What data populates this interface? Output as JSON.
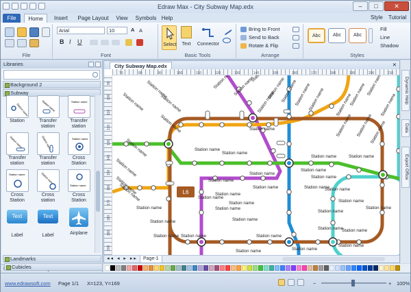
{
  "window": {
    "title": "Edraw Max - City Subway Map.edx"
  },
  "tabs": {
    "file": "File",
    "home": "Home",
    "insert": "Insert",
    "page_layout": "Page Layout",
    "view": "View",
    "symbols": "Symbols",
    "help": "Help",
    "style": "Style",
    "tutorial": "Tutorial"
  },
  "ribbon": {
    "file_group": "File",
    "font_group": "Font",
    "font_name": "Arial",
    "font_size": "10",
    "basic_tools_group": "Basic Tools",
    "select": "Select",
    "text": "Text",
    "connector": "Connector",
    "arrange_group": "Arrange",
    "bring_front": "Bring to Front",
    "send_back": "Send to Back",
    "rotate_flip": "Rotate & Flip",
    "styles_group": "Styles",
    "style_abc": "Abc",
    "fill": "Fill",
    "line": "Line",
    "shadow": "Shadow"
  },
  "libraries": {
    "title": "Libraries",
    "categories": {
      "background": "Background 2",
      "subway": "Subway",
      "landmarks": "Landmarks",
      "cubicles": "Cubicles"
    },
    "shapes": [
      "Station",
      "Transfer station",
      "Transfer station",
      "Transfer station",
      "Transfer station",
      "Cross Station",
      "Cross Station",
      "Cross station",
      "Cross Station",
      "Label",
      "Label",
      "Airplane"
    ],
    "shape_texts": {
      "label1": "Text",
      "label2": "Text",
      "station": "Station name"
    },
    "footer_libraries": "Libraries",
    "footer_manager": "Manager"
  },
  "document": {
    "tab": "City Subway Map.edx",
    "page": "Page-1",
    "ruler_h": [
      "70",
      "80",
      "90",
      "100",
      "110",
      "120",
      "130",
      "140",
      "150",
      "160",
      "170",
      "180",
      "190",
      "200",
      "210"
    ],
    "ruler_v": [
      "90",
      "100",
      "110",
      "120",
      "130",
      "140",
      "150",
      "160",
      "170",
      "180",
      "190",
      "200"
    ],
    "station_label": "Station name",
    "line_badge": "L6"
  },
  "side_tabs": {
    "dynamic_help": "Dynamic Help",
    "data": "Data",
    "export_office": "Export Office"
  },
  "status": {
    "website": "www.edrawsoft.com",
    "page": "Page 1/1",
    "coords": "X=123, Y=169",
    "zoom": "100%"
  },
  "colors": {
    "line_brown": "#a55a24",
    "line_orange": "#f0a513",
    "line_green": "#4cbf2b",
    "line_purple": "#b24ccc",
    "line_blue": "#1f8ed6",
    "line_teal": "#50d0cc",
    "ribbon_file": "#2e68b7"
  }
}
